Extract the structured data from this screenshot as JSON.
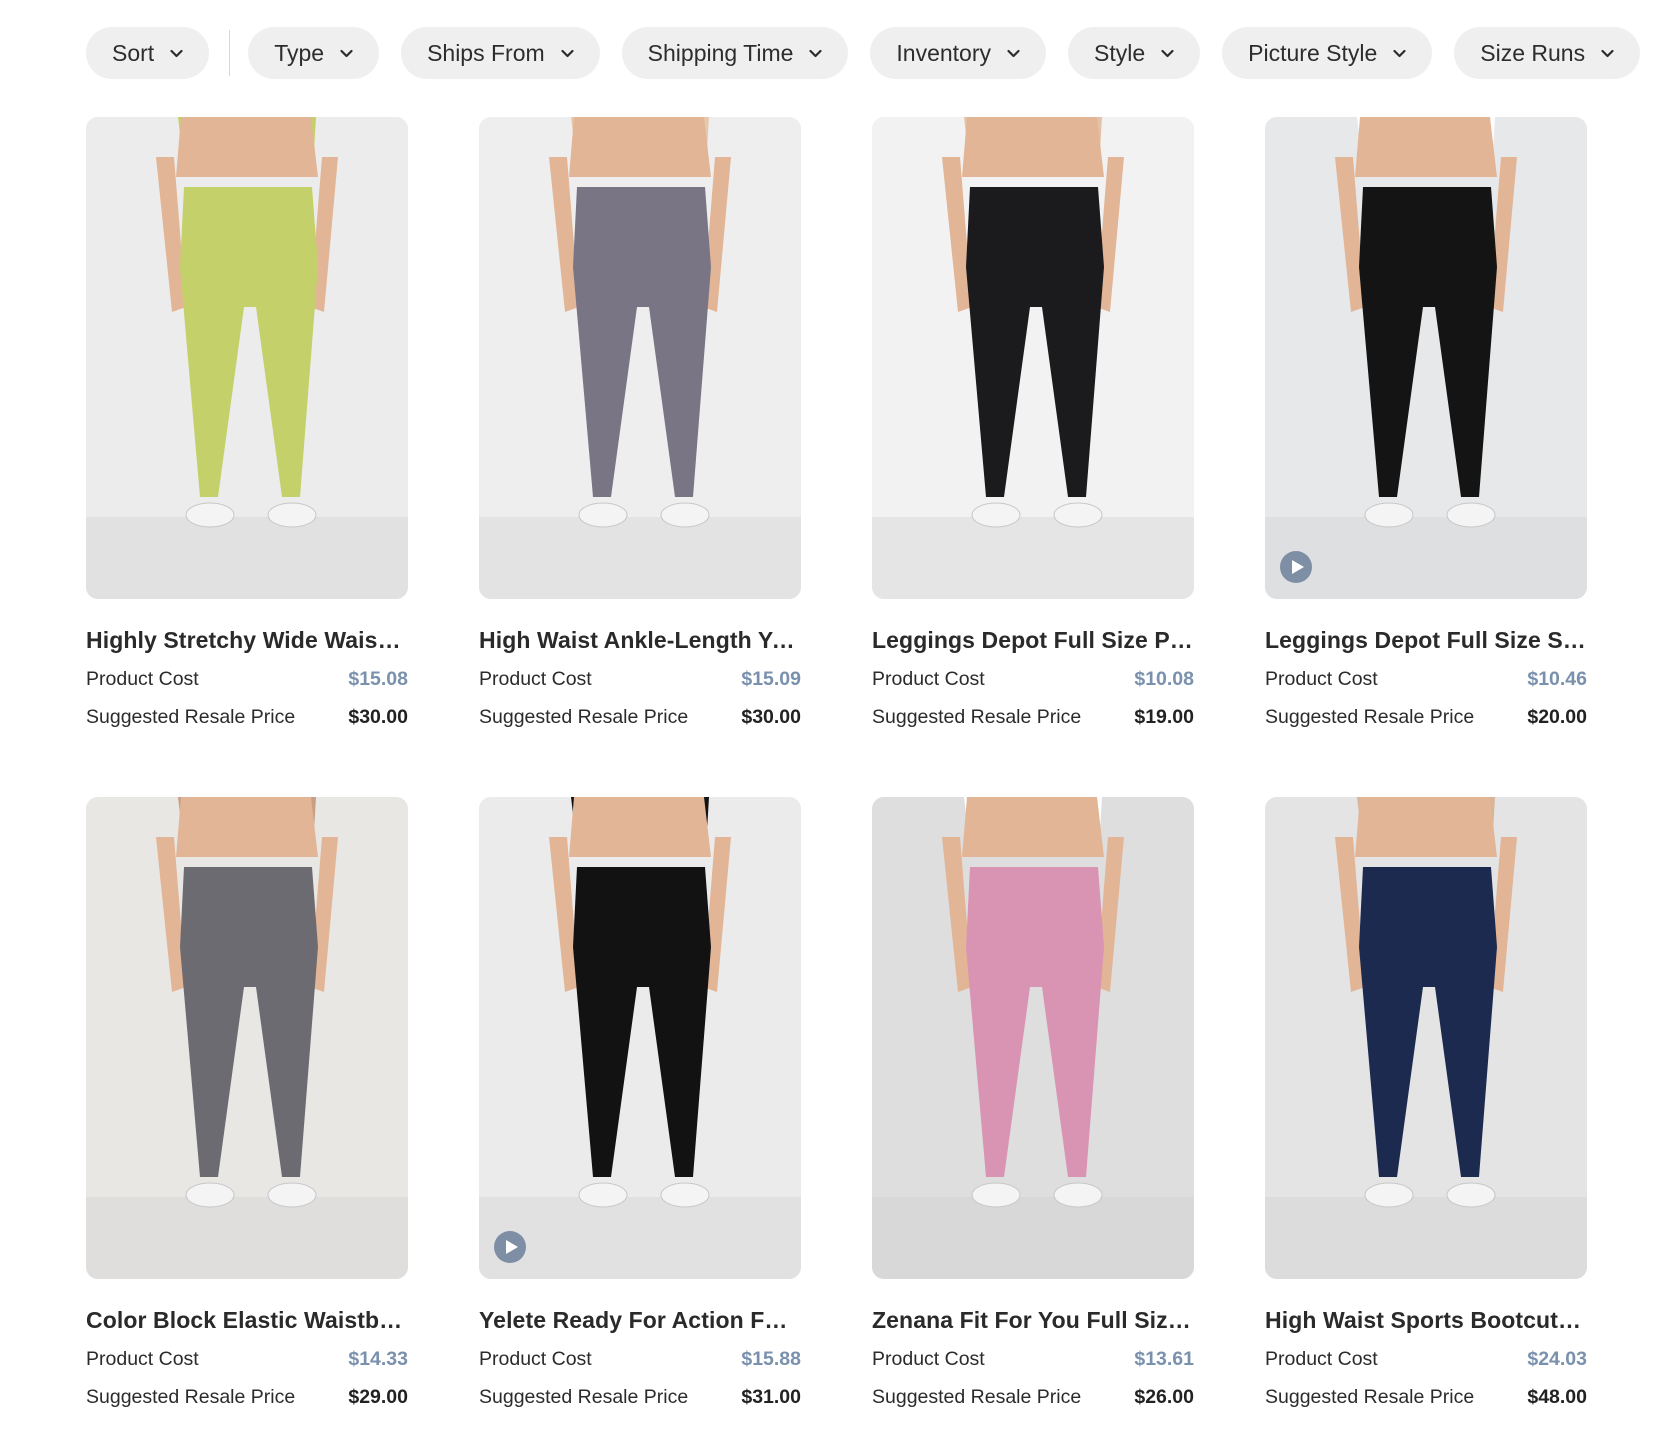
{
  "filters": [
    {
      "label": "Sort"
    },
    {
      "label": "Type"
    },
    {
      "label": "Ships From"
    },
    {
      "label": "Shipping Time"
    },
    {
      "label": "Inventory"
    },
    {
      "label": "Style"
    },
    {
      "label": "Picture Style"
    },
    {
      "label": "Size Runs"
    }
  ],
  "labels": {
    "product_cost": "Product Cost",
    "suggested_resale": "Suggested Resale Price"
  },
  "colors": {
    "pill_bg": "#efefef",
    "cost_accent": "#7a91ad",
    "play_badge": "#7d8ea5"
  },
  "products": [
    {
      "title": "Highly Stretchy Wide Waistband Yoga Leggings",
      "cost": "$15.08",
      "resale": "$30.00",
      "has_video": false,
      "pant_color": "#c4d16a",
      "bg": "#ececec",
      "top_color": "#c4d16a"
    },
    {
      "title": "High Waist Ankle-Length Yoga Leggings",
      "cost": "$15.09",
      "resale": "$30.00",
      "has_video": false,
      "pant_color": "#7a7585",
      "bg": "#eeeeee",
      "top_color": "#e6c9ad"
    },
    {
      "title": "Leggings Depot Full Size PU Leather Leggings",
      "cost": "$10.08",
      "resale": "$19.00",
      "has_video": false,
      "pant_color": "#1b1b1d",
      "bg": "#f2f2f2",
      "top_color": "#e3c2a5"
    },
    {
      "title": "Leggings Depot Full Size Strengthen and Lengthen Leggings",
      "cost": "$10.46",
      "resale": "$20.00",
      "has_video": true,
      "pant_color": "#141414",
      "bg": "#e7e8ea",
      "top_color": "#ffffff"
    },
    {
      "title": "Color Block Elastic Waistband Leggings",
      "cost": "$14.33",
      "resale": "$29.00",
      "has_video": false,
      "pant_color": "#6d6b72",
      "bg": "#e9e7e4",
      "top_color": "#c89f82"
    },
    {
      "title": "Yelete Ready For Action Full Size Leggings",
      "cost": "$15.88",
      "resale": "$31.00",
      "has_video": true,
      "pant_color": "#121212",
      "bg": "#ebebeb",
      "top_color": "#121212"
    },
    {
      "title": "Zenana Fit For You Full Size High Waist Leggings",
      "cost": "$13.61",
      "resale": "$26.00",
      "has_video": false,
      "pant_color": "#d894b2",
      "bg": "#dedede",
      "top_color": "#ffffff"
    },
    {
      "title": "High Waist Sports Bootcut Yoga Pants",
      "cost": "$24.03",
      "resale": "$48.00",
      "has_video": false,
      "pant_color": "#1c2a4f",
      "bg": "#e4e4e4",
      "top_color": "#d9b598"
    }
  ]
}
